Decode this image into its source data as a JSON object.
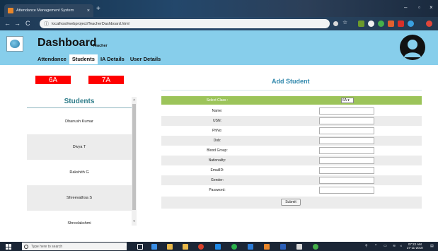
{
  "browser": {
    "tab_title": "Attendance Management System",
    "tab_close": "×",
    "new_tab": "+",
    "url": "localhost/webproject/TeacherDashboard.html",
    "window_controls": [
      "–",
      "▫",
      "×"
    ]
  },
  "header": {
    "title": "Dashboard",
    "subtitle": "Teacher",
    "menu": [
      {
        "label": "Attendance"
      },
      {
        "label": "Students"
      },
      {
        "label": "IA Details"
      },
      {
        "label": "User Details"
      }
    ]
  },
  "classes": [
    {
      "label": "6A"
    },
    {
      "label": "7A"
    }
  ],
  "students": {
    "title": "Students",
    "list": [
      {
        "name": "Dhanush Kumar"
      },
      {
        "name": "Divya T"
      },
      {
        "name": "Rakshith G"
      },
      {
        "name": "Shreevathsa S"
      },
      {
        "name": "Shreelakshmi"
      }
    ]
  },
  "add_student": {
    "title": "Add Student",
    "select_class_label": "Select Class :",
    "select_class_value": "6A ▾",
    "fields": [
      {
        "label": "Name:"
      },
      {
        "label": "USN:"
      },
      {
        "label": "PhNo:"
      },
      {
        "label": "Dob:"
      },
      {
        "label": "Blood Group:"
      },
      {
        "label": "Nationality:"
      },
      {
        "label": "EmailID:"
      },
      {
        "label": "Gender:"
      },
      {
        "label": "Password:"
      }
    ],
    "submit_label": "Submit"
  },
  "taskbar": {
    "search_placeholder": "Type here to search",
    "time": "07:22 AM",
    "date": "27-11-2018"
  },
  "colors": {
    "header_bg": "#87ceeb",
    "class_button": "#ff0000",
    "form_header": "#9cc45a",
    "accent_text": "#2e86ab"
  }
}
